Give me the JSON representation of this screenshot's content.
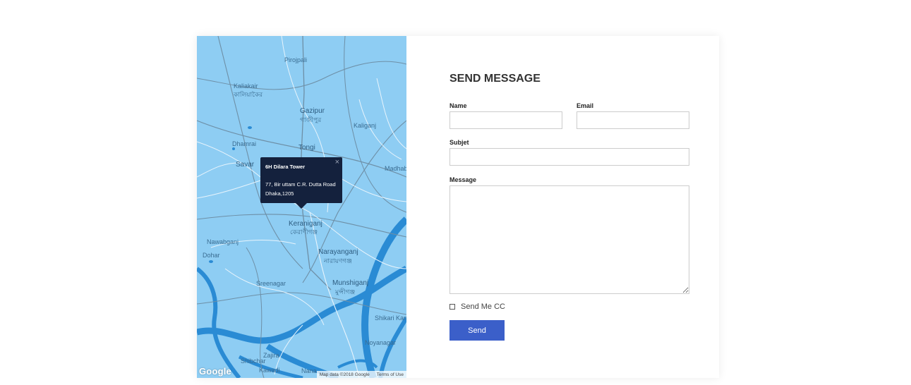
{
  "map": {
    "places": [
      {
        "name": "Pirojpali",
        "size": "small"
      },
      {
        "name": "Kaliakair",
        "size": "small"
      },
      {
        "name": "কালিয়াকৈর",
        "size": "small"
      },
      {
        "name": "Gazipur",
        "size": "big"
      },
      {
        "name": "গাজীপুর",
        "size": "small"
      },
      {
        "name": "Kaliganj",
        "size": "small"
      },
      {
        "name": "Dhamrai",
        "size": "small"
      },
      {
        "name": "Savar",
        "size": "big"
      },
      {
        "name": "Tongi",
        "size": "big"
      },
      {
        "name": "Keraniganj",
        "size": "big"
      },
      {
        "name": "কেরাণীগঞ্জ",
        "size": "small"
      },
      {
        "name": "Narayanganj",
        "size": "big"
      },
      {
        "name": "নারায়ণগঞ্জ",
        "size": "small"
      },
      {
        "name": "Nawabganj",
        "size": "small"
      },
      {
        "name": "Dohar",
        "size": "small"
      },
      {
        "name": "Sreenagar",
        "size": "small"
      },
      {
        "name": "Munshiganj",
        "size": "big"
      },
      {
        "name": "মুন্সীগঞ্জ",
        "size": "small"
      },
      {
        "name": "Madhabdi",
        "size": "small"
      },
      {
        "name": "Shikari Kandi",
        "size": "small"
      },
      {
        "name": "Noyanagar",
        "size": "small"
      },
      {
        "name": "Zajira",
        "size": "small"
      },
      {
        "name": "Shibchar",
        "size": "small"
      },
      {
        "name": "Kawadi",
        "size": "small"
      },
      {
        "name": "Nana",
        "size": "small"
      }
    ],
    "infowindow": {
      "title": "6H Dilara Tower",
      "address_line1": "77, Bir uttam C.R. Dutta Road",
      "address_line2": "Dhaka,1205",
      "close_glyph": "×"
    },
    "logo_text": "Google",
    "map_data_text": "Map data ©2018 Google",
    "terms_text": "Terms of Use"
  },
  "form": {
    "heading": "SEND MESSAGE",
    "name_label": "Name",
    "email_label": "Email",
    "subject_label": "Subjet",
    "message_label": "Message",
    "cc_label": "Send Me CC",
    "cc_checked": false,
    "send_label": "Send",
    "name_value": "",
    "email_value": "",
    "subject_value": "",
    "message_value": ""
  },
  "colors": {
    "map_land": "#8ecdf3",
    "map_water": "#2a8bd4",
    "infowindow_bg": "#14213d",
    "button": "#3b5fc9"
  }
}
